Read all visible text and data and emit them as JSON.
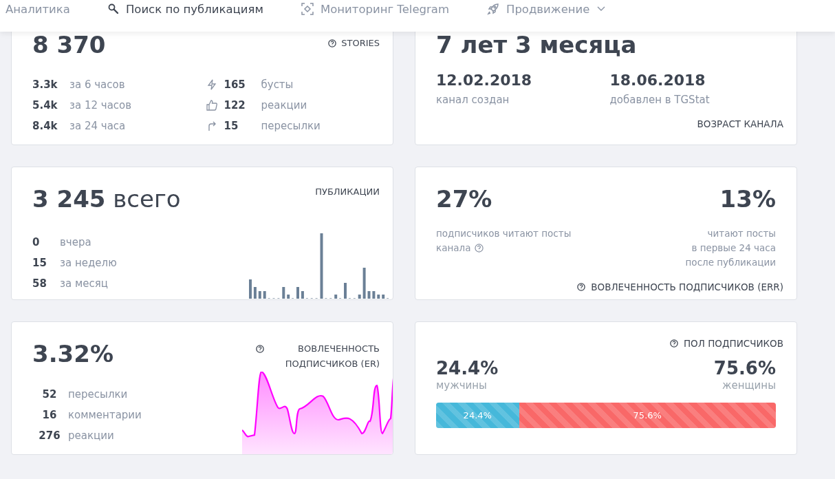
{
  "nav": [
    {
      "label": "Аналитика",
      "selected": false
    },
    {
      "label": "Поиск по публикациям",
      "selected": true
    },
    {
      "label": "Мониторинг Telegram",
      "selected": false
    },
    {
      "label": "Продвижение",
      "selected": false
    }
  ],
  "stories": {
    "label": "STORIES",
    "value": "8 370",
    "views": [
      {
        "value": "3.3k",
        "label": "за 6 часов"
      },
      {
        "value": "5.4k",
        "label": "за 12 часов"
      },
      {
        "value": "8.4k",
        "label": "за 24 часа"
      }
    ],
    "actions": [
      {
        "value": "165",
        "label": "бусты"
      },
      {
        "value": "122",
        "label": "реакции"
      },
      {
        "value": "15",
        "label": "пересылки"
      }
    ]
  },
  "age": {
    "value": "7 лет 3 месяца",
    "dates": [
      {
        "value": "12.02.2018",
        "label": "канал создан"
      },
      {
        "value": "18.06.2018",
        "label": "добавлен в TGStat"
      }
    ],
    "label": "ВОЗРАСТ КАНАЛА"
  },
  "posts": {
    "label": "ПУБЛИКАЦИИ",
    "value": "**3 245** всего",
    "stats": [
      {
        "value": "0",
        "label": "вчера"
      },
      {
        "value": "15",
        "label": "за неделю"
      },
      {
        "value": "58",
        "label": "за месяц"
      }
    ]
  },
  "err": {
    "label": "ВОВЛЕЧЕННОСТЬ ПОДПИСЧИКОВ (ERR)",
    "left": {
      "value": "27%",
      "lines": [
        "подписчиков читают посты",
        "канала"
      ]
    },
    "right": {
      "value": "13%",
      "lines": [
        "читают посты",
        "в первые 24 часа",
        "после публикации"
      ]
    }
  },
  "er": {
    "label": "ВОВЛЕЧЕННОСТЬ ПОДПИСЧИКОВ (ER)",
    "value": "3.32%",
    "stats": [
      {
        "value": "52",
        "label": "пересылки"
      },
      {
        "value": "16",
        "label": "комментарии"
      },
      {
        "value": "276",
        "label": "реакции"
      }
    ]
  },
  "gender": {
    "label": "ПОЛ ПОДПИСЧИКОВ",
    "groups": [
      {
        "value": "24.4%",
        "label": "мужчины",
        "bar_label": "24.4%",
        "level": 0.244,
        "color": "#46b8da"
      },
      {
        "value": "75.6%",
        "label": "женщины",
        "bar_label": "75.6%",
        "level": 0.756,
        "color": "#f96868"
      }
    ]
  }
}
